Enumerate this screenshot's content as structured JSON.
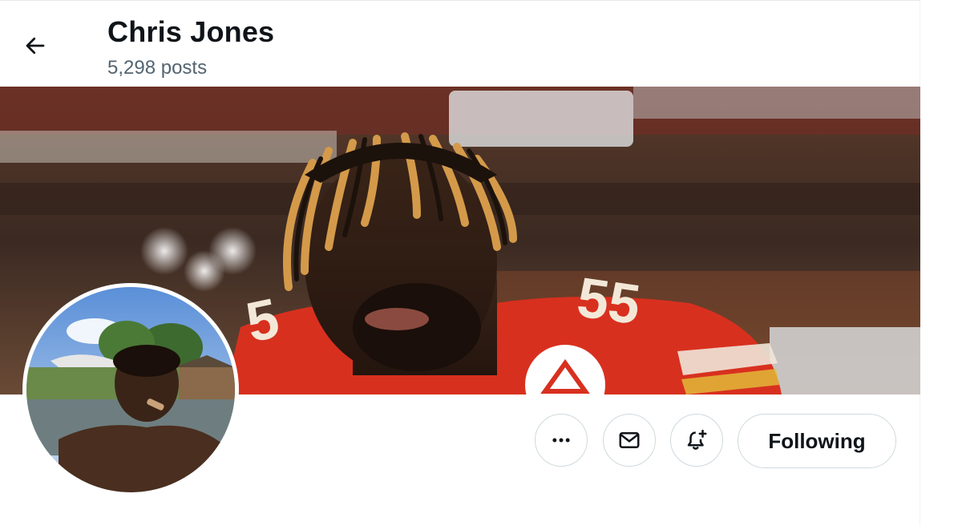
{
  "header": {
    "name": "Chris Jones",
    "post_count": "5,298 posts",
    "back_icon": "arrow-left-icon"
  },
  "banner": {
    "description_icon": "banner-photo",
    "jersey_number": "55"
  },
  "avatar": {
    "icon": "profile-photo"
  },
  "actions": {
    "more_icon": "ellipsis-icon",
    "message_icon": "envelope-icon",
    "notify_icon": "bell-plus-icon",
    "follow_label": "Following"
  },
  "colors": {
    "border": "#cfd9de",
    "muted_text": "#536471",
    "text": "#0f1419",
    "jersey_red": "#d8301f"
  }
}
